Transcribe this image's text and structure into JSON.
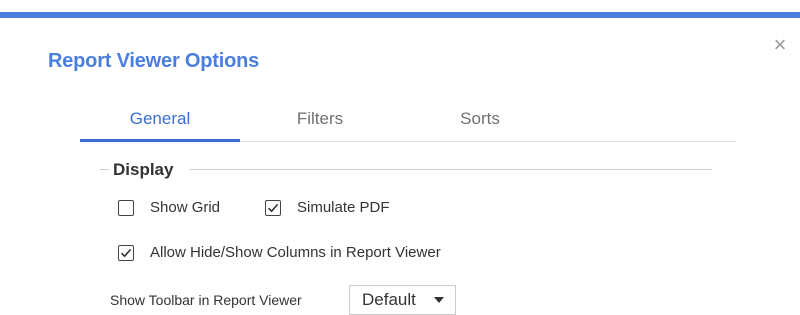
{
  "dialog": {
    "title": "Report Viewer Options",
    "close_glyph": "×"
  },
  "tabs": [
    {
      "label": "General",
      "active": true
    },
    {
      "label": "Filters",
      "active": false
    },
    {
      "label": "Sorts",
      "active": false
    }
  ],
  "display_section": {
    "legend": "Display",
    "options": [
      {
        "label": "Show Grid",
        "checked": false
      },
      {
        "label": "Simulate PDF",
        "checked": true
      },
      {
        "label": "Allow Hide/Show Columns in Report Viewer",
        "checked": true
      }
    ]
  },
  "toolbar_setting": {
    "label": "Show Toolbar in Report Viewer",
    "selected": "Default"
  },
  "colors": {
    "accent": "#4a7fe0",
    "active_tab": "#3a6fd0",
    "inactive_tab": "#707070",
    "text": "#333333"
  },
  "icons": {
    "close": "close-icon",
    "checkmark": "checkmark-icon",
    "dropdown": "caret-down-icon"
  }
}
